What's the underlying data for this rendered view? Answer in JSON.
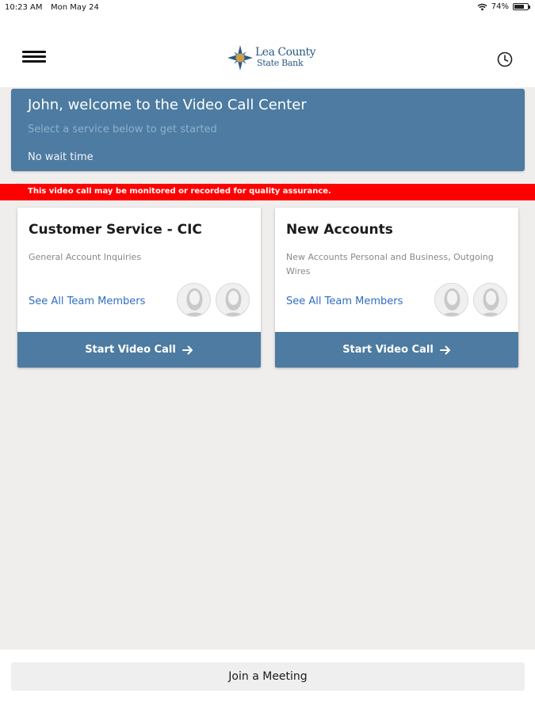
{
  "status_bar": {
    "time": "10:23 AM",
    "date": "Mon May 24",
    "battery": "74%",
    "battery_level": 0.74
  },
  "header": {
    "logo_line1": "Lea County",
    "logo_line2": "State Bank"
  },
  "welcome": {
    "title": "John, welcome to the Video Call Center",
    "subtitle": "Select a service below to get started",
    "wait": "No wait time"
  },
  "notice": "This video call may be monitored or recorded for quality assurance.",
  "services": [
    {
      "name": "Customer Service - CIC",
      "description": "General Account Inquiries",
      "team_link": "See All Team Members",
      "button": "Start Video Call"
    },
    {
      "name": "New Accounts",
      "description": "New Accounts Personal and Business, Outgoing Wires",
      "team_link": "See All Team Members",
      "button": "Start Video Call"
    }
  ],
  "footer": {
    "join_label": "Join a Meeting"
  },
  "colors": {
    "primary": "#4d7ba1",
    "alert": "#ff0000",
    "link": "#2f6ec2"
  }
}
